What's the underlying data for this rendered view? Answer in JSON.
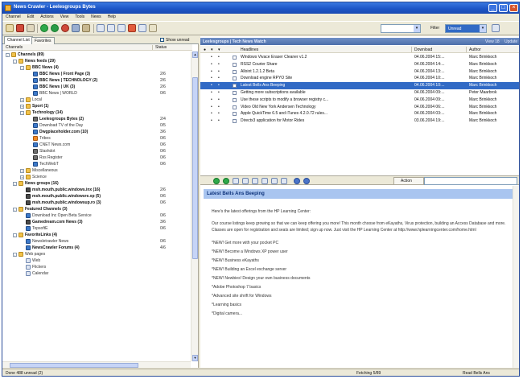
{
  "window": {
    "title": "News Crawler - Leelesgroups Bytes",
    "buttons": [
      "_",
      "□",
      "×"
    ]
  },
  "menubar": [
    "Channel",
    "Edit",
    "Actions",
    "View",
    "Tools",
    "News",
    "Help"
  ],
  "toolbar": {
    "icons": [
      "new-icon",
      "open-icon",
      "print-icon",
      "refresh-icon",
      "stop-icon",
      "forward-icon",
      "search-icon",
      "filter-icon",
      "settings-icon",
      "window-icon",
      "list-icon",
      "grid-icon",
      "star-icon",
      "help-icon"
    ],
    "filter_label": "Filter",
    "filter_value": "Unread"
  },
  "left_panel": {
    "tabs": [
      "Channel List",
      "Favorites"
    ],
    "checkbox_label": "Show unread",
    "columns": {
      "name": "Channels",
      "status": "Status"
    },
    "tree": [
      {
        "label": "Channels (89)",
        "level": 0,
        "bold": true,
        "exp": "-",
        "icon": "folder-icon",
        "count": ""
      },
      {
        "label": "News feeds (29)",
        "level": 1,
        "bold": true,
        "exp": "-",
        "icon": "folder-icon",
        "count": ""
      },
      {
        "label": "BBC News (4)",
        "level": 2,
        "bold": true,
        "exp": "-",
        "icon": "folder-icon",
        "count": ""
      },
      {
        "label": "BBC News | Front Page (3)",
        "level": 3,
        "bold": true,
        "exp": "",
        "icon": "feed-icon",
        "count": "2/6"
      },
      {
        "label": "BBC News | TECHNOLOGY (2)",
        "level": 3,
        "bold": true,
        "exp": "",
        "icon": "feed-icon",
        "count": "2/6"
      },
      {
        "label": "BBC News | UK (3)",
        "level": 3,
        "bold": true,
        "exp": "",
        "icon": "feed-icon",
        "count": "2/6"
      },
      {
        "label": "BBC News | WORLD",
        "level": 3,
        "bold": false,
        "exp": "",
        "icon": "feed-icon",
        "count": "0/6"
      },
      {
        "label": "Local",
        "level": 2,
        "bold": false,
        "exp": "+",
        "icon": "folder-icon",
        "count": ""
      },
      {
        "label": "Sport (1)",
        "level": 2,
        "bold": true,
        "exp": "+",
        "icon": "folder-icon",
        "count": ""
      },
      {
        "label": "Technology (14)",
        "level": 2,
        "bold": true,
        "exp": "-",
        "icon": "folder-icon",
        "count": ""
      },
      {
        "label": "Leelesgroups Bytes (2)",
        "level": 3,
        "bold": true,
        "exp": "",
        "icon": "person-icon",
        "count": "2/4"
      },
      {
        "label": "Download TV of the Day",
        "level": 3,
        "bold": false,
        "exp": "",
        "icon": "feed-icon",
        "count": "0/5"
      },
      {
        "label": "Dwgplaceholder.com (10)",
        "level": 3,
        "bold": true,
        "exp": "",
        "icon": "feed-icon",
        "count": "3/6"
      },
      {
        "label": "Tribes",
        "level": 3,
        "bold": false,
        "exp": "",
        "icon": "rss-icon",
        "count": "0/6"
      },
      {
        "label": "CNET News.com",
        "level": 3,
        "bold": false,
        "exp": "",
        "icon": "feed-icon",
        "count": "0/6"
      },
      {
        "label": "Slashdot",
        "level": 3,
        "bold": false,
        "exp": "",
        "icon": "person-icon",
        "count": "0/6"
      },
      {
        "label": "Rss Register",
        "level": 3,
        "bold": false,
        "exp": "",
        "icon": "person-icon",
        "count": "0/6"
      },
      {
        "label": "TechWebT",
        "level": 3,
        "bold": false,
        "exp": "",
        "icon": "feed-icon",
        "count": "0/6"
      },
      {
        "label": "Miscellaneous",
        "level": 2,
        "bold": false,
        "exp": "+",
        "icon": "folder-icon",
        "count": ""
      },
      {
        "label": "Science",
        "level": 2,
        "bold": false,
        "exp": "+",
        "icon": "folder-icon",
        "count": ""
      },
      {
        "label": "News groups (16)",
        "level": 1,
        "bold": true,
        "exp": "-",
        "icon": "folder-icon",
        "count": ""
      },
      {
        "label": "msh.mouth.public.windows.inx (16)",
        "level": 2,
        "bold": true,
        "exp": "",
        "icon": "group-icon",
        "count": "2/6"
      },
      {
        "label": "msh.mouth.public.windowsre.xp (5)",
        "level": 2,
        "bold": true,
        "exp": "",
        "icon": "group-icon",
        "count": "0/6"
      },
      {
        "label": "msh.mouth.public.windowsup.ro (3)",
        "level": 2,
        "bold": true,
        "exp": "",
        "icon": "group-icon",
        "count": "0/6"
      },
      {
        "label": "Featured Channels (3)",
        "level": 1,
        "bold": true,
        "exp": "-",
        "icon": "folder-icon",
        "count": ""
      },
      {
        "label": "Download Inc Open Beta Service",
        "level": 2,
        "bold": false,
        "exp": "",
        "icon": "feed-icon",
        "count": "0/6"
      },
      {
        "label": "Gamedream.com News (3)",
        "level": 2,
        "bold": true,
        "exp": "",
        "icon": "group-icon",
        "count": "3/6"
      },
      {
        "label": "TopsoftE",
        "level": 2,
        "bold": false,
        "exp": "",
        "icon": "feed-icon",
        "count": "0/6"
      },
      {
        "label": "FavoriteLinks (4)",
        "level": 1,
        "bold": true,
        "exp": "-",
        "icon": "folder-icon",
        "count": ""
      },
      {
        "label": "Newsletrawler News",
        "level": 2,
        "bold": false,
        "exp": "",
        "icon": "feed-icon",
        "count": "0/6"
      },
      {
        "label": "NewsCrawler Forums (4)",
        "level": 2,
        "bold": true,
        "exp": "",
        "icon": "feed-icon",
        "count": "4/6"
      },
      {
        "label": "Web pages",
        "level": 1,
        "bold": false,
        "exp": "-",
        "icon": "folder-icon",
        "count": ""
      },
      {
        "label": "Web",
        "level": 2,
        "bold": false,
        "exp": "",
        "icon": "page-icon",
        "count": ""
      },
      {
        "label": "Flickers",
        "level": 2,
        "bold": false,
        "exp": "",
        "icon": "page-icon",
        "count": ""
      },
      {
        "label": "Calendar",
        "level": 2,
        "bold": false,
        "exp": "",
        "icon": "page-icon",
        "count": ""
      }
    ]
  },
  "right_panel": {
    "feed_title": "Leelesgroups | Tech News Watch",
    "feed_meta": [
      "View 18",
      "Update"
    ],
    "columns": [
      "Headlines",
      "Download",
      "Author"
    ],
    "rows": [
      {
        "headline": "Windows Vivace Eraser Cleaner v1.2",
        "date": "04.06.2004 15:...",
        "author": "Marc Brinkkoch",
        "selected": false
      },
      {
        "headline": "RSS2 Courier Share",
        "date": "04.06.2004 14:...",
        "author": "Marc Brinkkoch",
        "selected": false
      },
      {
        "headline": "Alloint 1.2.1.2 Beta",
        "date": "04.06.2004 13:...",
        "author": "Marc Brinkkoch",
        "selected": false
      },
      {
        "headline": "Download engine RPYO Site",
        "date": "04.06.2004 10:...",
        "author": "Marc Brinkkoch",
        "selected": false
      },
      {
        "headline": "Latest Bells Ans Beeping",
        "date": "04.06.2004 10:...",
        "author": "Marc Brinkkoch",
        "selected": true
      },
      {
        "headline": "Getting more subscriptions available",
        "date": "04.06.2004 09:...",
        "author": "Peter Maarbrok",
        "selected": false
      },
      {
        "headline": "Use these scripts to modify a browser registry c...",
        "date": "04.06.2004 09:...",
        "author": "Marc Brinkkoch",
        "selected": false
      },
      {
        "headline": "Video Old New York Andersen Technology",
        "date": "04.06.2004 06:...",
        "author": "Marc Brinkkoch",
        "selected": false
      },
      {
        "headline": "Apple QuickTime 6.5 and iTunes 4.2.0.72 rules...",
        "date": "04.06.2004 03:...",
        "author": "Marc Brinkkoch",
        "selected": false
      },
      {
        "headline": "Directx3 application for Motor Rides",
        "date": "03.06.2004 19:...",
        "author": "Marc Brinkkoch",
        "selected": false
      }
    ],
    "preview_action": "Action",
    "preview": {
      "title": "Latest Bells Ans Beeping",
      "paragraphs": [
        "Here's the latest offerings from the HP Learning Center:",
        "Our course listings keep growing so that we can keep offering you more! This month choose from eKayaths, Virus protection, building an Access Database and more. Classes are open for registration and seats are limited; sign up now. Just visit the HP Learning Center at http://www.hplearningcenter.com/home.html",
        "*NEW! Get more with your pocket PC",
        "*NEW! Become a Windows XP power user",
        "*NEW! Business eKayaths",
        "*NEW! Building an Excel exchange server",
        "*NEW! Newbies! Design your own business documents",
        "*Adobe Photoshop 7 basics",
        "*Advanced site shrift for Windows",
        "*Learning basics",
        "*Digital camera..."
      ]
    }
  },
  "statusbar": {
    "left": "Done 488 unread (2)",
    "mid": "Fetching 5/89",
    "right": "Read Bells Ans"
  },
  "colors": {
    "selection": "#316ac5",
    "titlebar": "#1d56c7",
    "preview_header": "#a9c5f0",
    "folder": "#f2c24a",
    "feed": "#3d79c8"
  }
}
